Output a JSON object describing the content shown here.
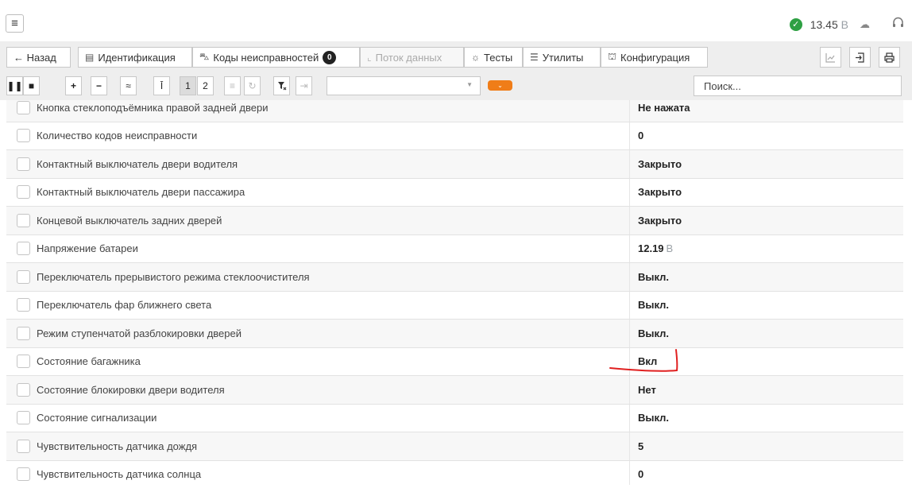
{
  "topbar": {
    "menu_icon": "hamburger-icon",
    "status_icon": "check-circle-icon",
    "status_ok_color": "#2ea043",
    "voltage_value": "13.45",
    "voltage_unit": "В",
    "cloud_icon": "cloud-icon",
    "headset_icon": "headset-icon"
  },
  "tabs": {
    "back": "← Назад",
    "identification": "Идентификация",
    "fault_codes": "Коды неисправностей",
    "fault_codes_badge": "0",
    "data_stream": "Поток данных",
    "tests": "Тесты",
    "utilities": "Утилиты",
    "configuration": "Конфигурация"
  },
  "toolbar": {
    "page_1": "1",
    "page_2": "2",
    "search_placeholder": "Поиск..."
  },
  "rows": [
    {
      "name": "Кнопка стеклоподъёмника правой задней двери",
      "value": "Не нажата",
      "unit": ""
    },
    {
      "name": "Количество кодов неисправности",
      "value": "0",
      "unit": ""
    },
    {
      "name": "Контактный выключатель двери водителя",
      "value": "Закрыто",
      "unit": ""
    },
    {
      "name": "Контактный выключатель двери пассажира",
      "value": "Закрыто",
      "unit": ""
    },
    {
      "name": "Концевой выключатель задних дверей",
      "value": "Закрыто",
      "unit": ""
    },
    {
      "name": "Напряжение батареи",
      "value": "12.19",
      "unit": "В"
    },
    {
      "name": "Переключатель прерывистого режима стеклоочистителя",
      "value": "Выкл.",
      "unit": ""
    },
    {
      "name": "Переключатель фар ближнего света",
      "value": "Выкл.",
      "unit": ""
    },
    {
      "name": "Режим ступенчатой разблокировки дверей",
      "value": "Выкл.",
      "unit": ""
    },
    {
      "name": "Состояние багажника",
      "value": "Вкл",
      "unit": ""
    },
    {
      "name": "Состояние блокировки двери водителя",
      "value": "Нет",
      "unit": ""
    },
    {
      "name": "Состояние сигнализации",
      "value": "Выкл.",
      "unit": ""
    },
    {
      "name": "Чувствительность датчика дождя",
      "value": "5",
      "unit": ""
    },
    {
      "name": "Чувствительность датчика солнца",
      "value": "0",
      "unit": ""
    }
  ],
  "annotation_color": "#e02020"
}
